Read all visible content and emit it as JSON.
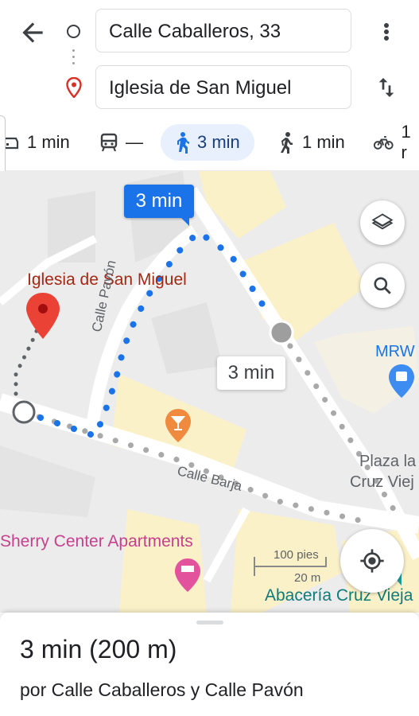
{
  "header": {
    "origin_value": "Calle Caballeros, 33",
    "destination_value": "Iglesia de San Miguel"
  },
  "modes": [
    {
      "icon": "car-icon",
      "label": "1 min"
    },
    {
      "icon": "transit-icon",
      "label": "—"
    },
    {
      "icon": "walk-icon",
      "label": "3 min",
      "active": true
    },
    {
      "icon": "ride-icon",
      "label": "1 min"
    },
    {
      "icon": "bike-icon",
      "label": "1 r"
    }
  ],
  "map": {
    "place_label": "Iglesia de San Miguel",
    "route_time_selected": "3 min",
    "route_time_alt": "3 min",
    "street_pavon": "Calle Pavón",
    "street_barja": "Calle Barja",
    "poi_mrw": "MRW",
    "poi_plaza_line1": "Plaza la",
    "poi_plaza_line2": "Cruz Viej",
    "poi_sherry": "Sherry Center Apartments",
    "poi_abaceria": "Abacería Cruz Vieja",
    "scale_ft": "100 pies",
    "scale_m": "20 m"
  },
  "sheet": {
    "summary": "3 min  (200 m)",
    "via": "por Calle Caballeros y Calle Pavón"
  },
  "colors": {
    "route_blue": "#1a73e8",
    "pin_red": "#ea4335",
    "place_label": "#a52714",
    "poi_pink": "#c5418d",
    "poi_teal": "#0f7b7b"
  }
}
